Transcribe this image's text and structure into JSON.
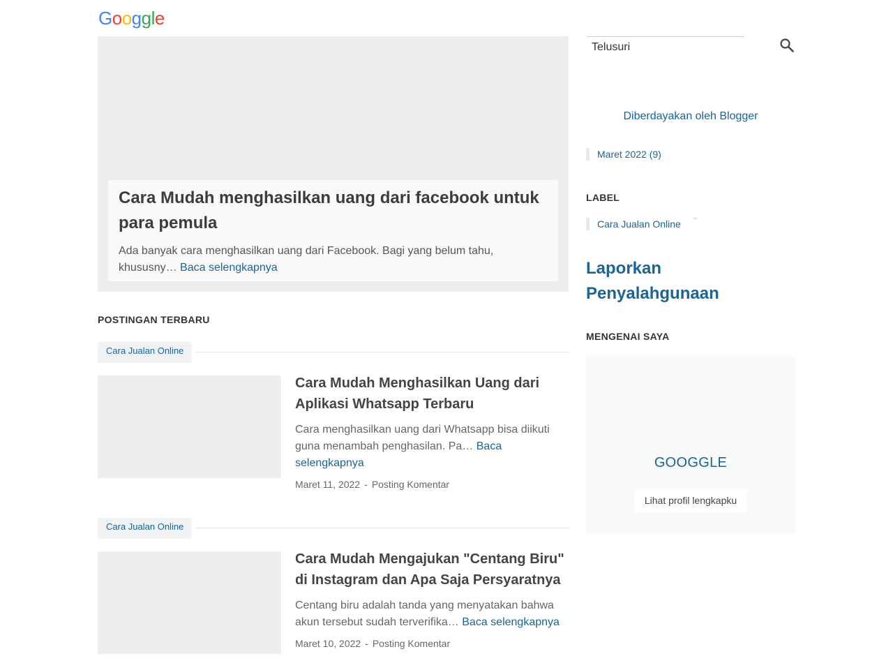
{
  "header": {
    "logo_letters": [
      {
        "char": "G",
        "color": "#4285F4"
      },
      {
        "char": "o",
        "color": "#EA4335"
      },
      {
        "char": "o",
        "color": "#FBBC05"
      },
      {
        "char": "g",
        "color": "#4285F4"
      },
      {
        "char": "g",
        "color": "#34A853"
      },
      {
        "char": "l",
        "color": "#34A853"
      },
      {
        "char": "e",
        "color": "#EA4335"
      }
    ]
  },
  "featured": {
    "title": "Cara Mudah menghasilkan uang dari facebook untuk para pemula",
    "snippet": "Ada banyak cara menghasilkan uang dari Facebook. Bagi yang belum tahu, khususny…",
    "read_more": "Baca selengkapnya"
  },
  "recent": {
    "section_title": "POSTINGAN TERBARU",
    "posts": [
      {
        "label": "Cara Jualan Online",
        "title": "Cara Mudah Menghasilkan Uang dari Aplikasi Whatsapp Terbaru",
        "snippet": "Cara menghasilkan uang dari Whatsapp bisa diikuti guna menambah penghasilan. Pa…",
        "read_more": "Baca selengkapnya",
        "date": "Maret 11, 2022",
        "separator": "-",
        "comment": "Posting Komentar"
      },
      {
        "label": "Cara Jualan Online",
        "title": "Cara Mudah Mengajukan \"Centang Biru\" di Instagram dan Apa Saja Persyaratnya",
        "snippet": "Centang biru adalah tanda yang menyatakan bahwa akun tersebut sudah terverifika…",
        "read_more": "Baca selengkapnya",
        "date": "Maret 10, 2022",
        "separator": "-",
        "comment": "Posting Komentar"
      }
    ]
  },
  "sidebar": {
    "search_placeholder": "Telusuri",
    "search_icon": "search-icon",
    "powered_by": "Diberdayakan oleh Blogger",
    "archive_item": "Maret 2022 (9)",
    "label_title": "LABEL",
    "label_item": "Cara Jualan Online",
    "report": "Laporkan Penyalahgunaan",
    "about_title": "MENGENAI SAYA",
    "profile_name": "GOOGGLE",
    "profile_button": "Lihat profil lengkapku"
  },
  "colors": {
    "link": "#1a6496",
    "hero_bg": "#ebedee",
    "card_bg": "#fafafa"
  }
}
